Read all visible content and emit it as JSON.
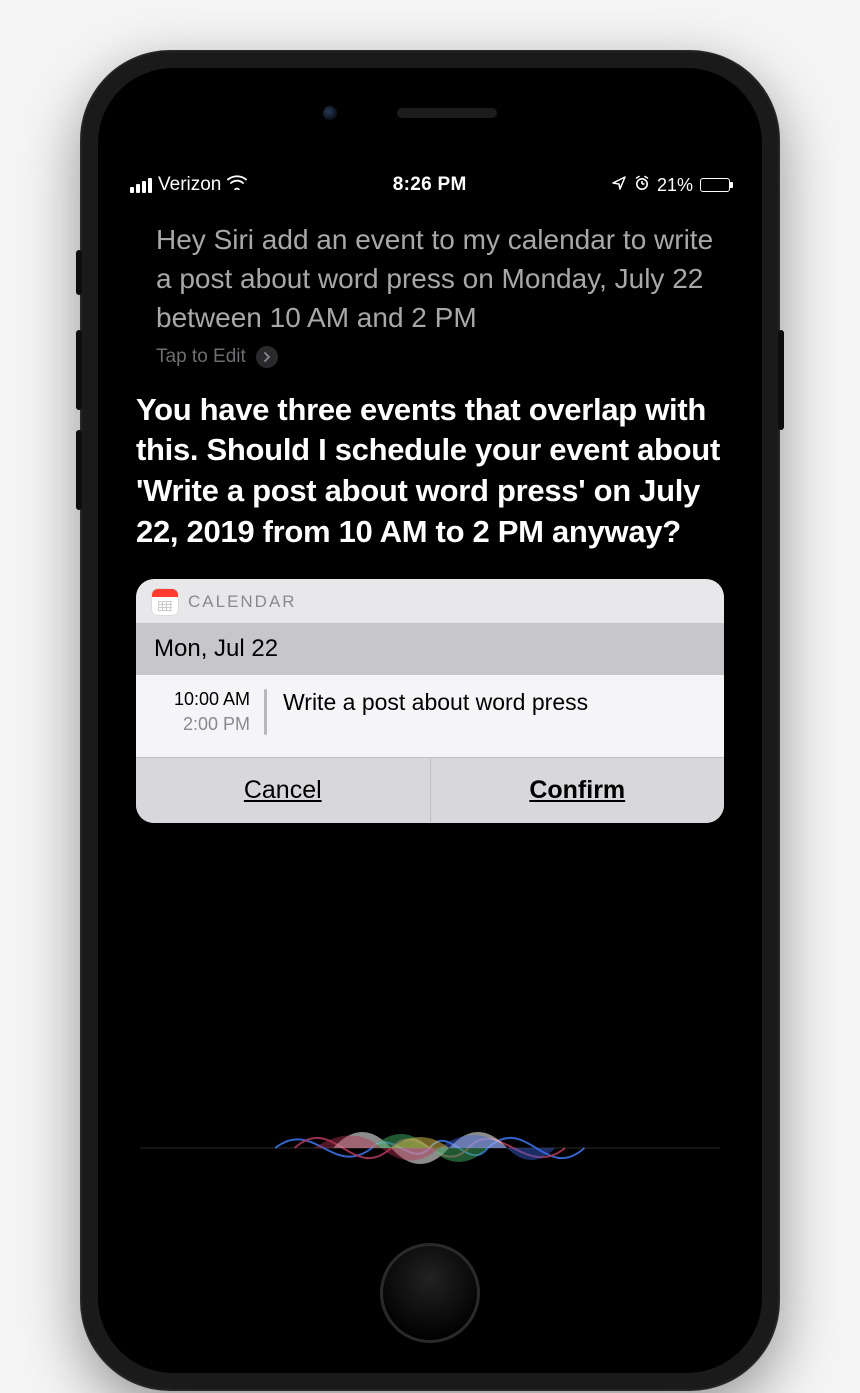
{
  "status_bar": {
    "carrier": "Verizon",
    "time": "8:26 PM",
    "battery_percent": "21%"
  },
  "user_request": "Hey Siri add an event to my calendar to write a post about word press on Monday, July 22 between 10 AM and 2 PM",
  "tap_to_edit": "Tap to Edit",
  "siri_response": "You have three events that overlap with this. Should I schedule your event about 'Write a post about word press' on July 22, 2019 from 10 AM to 2 PM anyway?",
  "card": {
    "app": "CALENDAR",
    "date": "Mon, Jul 22",
    "event": {
      "start": "10:00 AM",
      "end": "2:00 PM",
      "title": "Write a post about word press"
    },
    "cancel": "Cancel",
    "confirm": "Confirm"
  }
}
